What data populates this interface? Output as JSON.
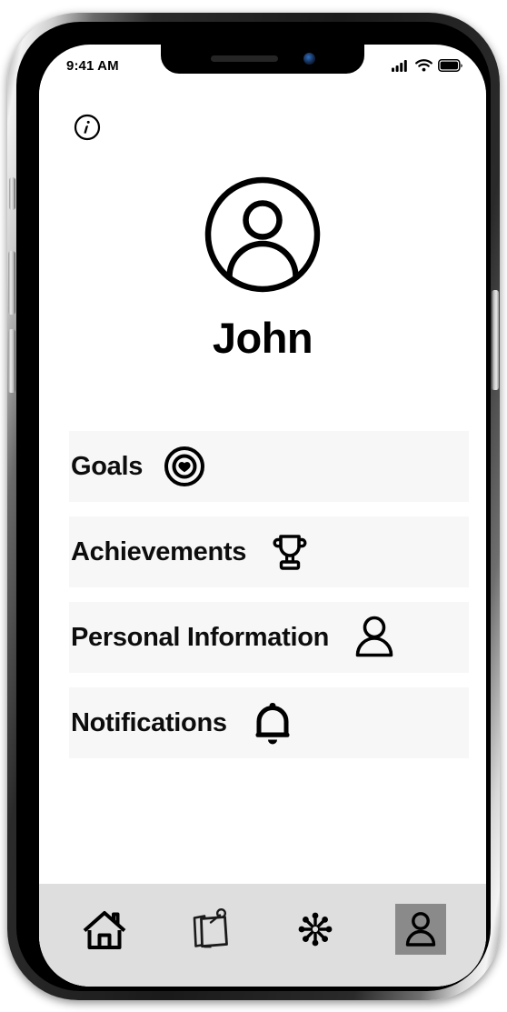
{
  "status_bar": {
    "time": "9:41 AM",
    "signal_icon": "cellular-signal-icon",
    "wifi_icon": "wifi-icon",
    "battery_icon": "battery-icon"
  },
  "header": {
    "info_icon": "info-icon",
    "avatar_icon": "user-avatar-icon",
    "user_name": "John"
  },
  "menu": {
    "items": [
      {
        "label": "Goals",
        "icon": "target-heart-icon"
      },
      {
        "label": "Achievements",
        "icon": "trophy-icon"
      },
      {
        "label": "Personal Information",
        "icon": "person-icon"
      },
      {
        "label": "Notifications",
        "icon": "bell-icon"
      }
    ]
  },
  "tab_bar": {
    "tabs": [
      {
        "name": "home",
        "icon": "home-icon",
        "active": false
      },
      {
        "name": "notes",
        "icon": "sticky-notes-icon",
        "active": false
      },
      {
        "name": "activity",
        "icon": "snowflake-icon",
        "active": false
      },
      {
        "name": "profile",
        "icon": "profile-icon",
        "active": true
      }
    ],
    "active_background_color": "#8a8a8a",
    "background_color": "#dedede"
  },
  "theme": {
    "row_background": "#f7f7f7",
    "text_color": "#0d0d0d",
    "screen_background": "#ffffff"
  }
}
